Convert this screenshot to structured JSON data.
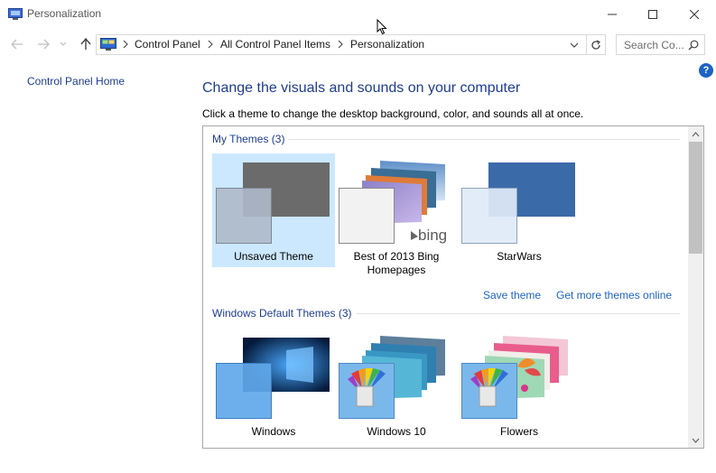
{
  "window": {
    "title": "Personalization",
    "icon": "personalization-icon",
    "controls": [
      "minimize-icon",
      "maximize-icon",
      "close-icon"
    ]
  },
  "address": {
    "breadcrumbs": [
      "Control Panel",
      "All Control Panel Items",
      "Personalization"
    ],
    "search_placeholder": "Search Co..."
  },
  "sidebar": {
    "home_link": "Control Panel Home"
  },
  "main": {
    "heading": "Change the visuals and sounds on your computer",
    "subtext": "Click a theme to change the desktop background, color, and sounds all at once."
  },
  "my_themes": {
    "header": "My Themes (3)",
    "items": [
      {
        "label": "Unsaved Theme",
        "selected": true
      },
      {
        "label": "Best of 2013 Bing Homepages",
        "selected": false
      },
      {
        "label": "StarWars",
        "selected": false
      }
    ],
    "save_link": "Save theme",
    "more_link": "Get more themes online"
  },
  "default_themes": {
    "header": "Windows Default Themes (3)",
    "items": [
      {
        "label": "Windows"
      },
      {
        "label": "Windows 10"
      },
      {
        "label": "Flowers"
      }
    ]
  },
  "bing_logo_text": "bing",
  "colors": {
    "link": "#1e63c4",
    "heading": "#1e3d8f",
    "selection": "#cce8ff"
  }
}
